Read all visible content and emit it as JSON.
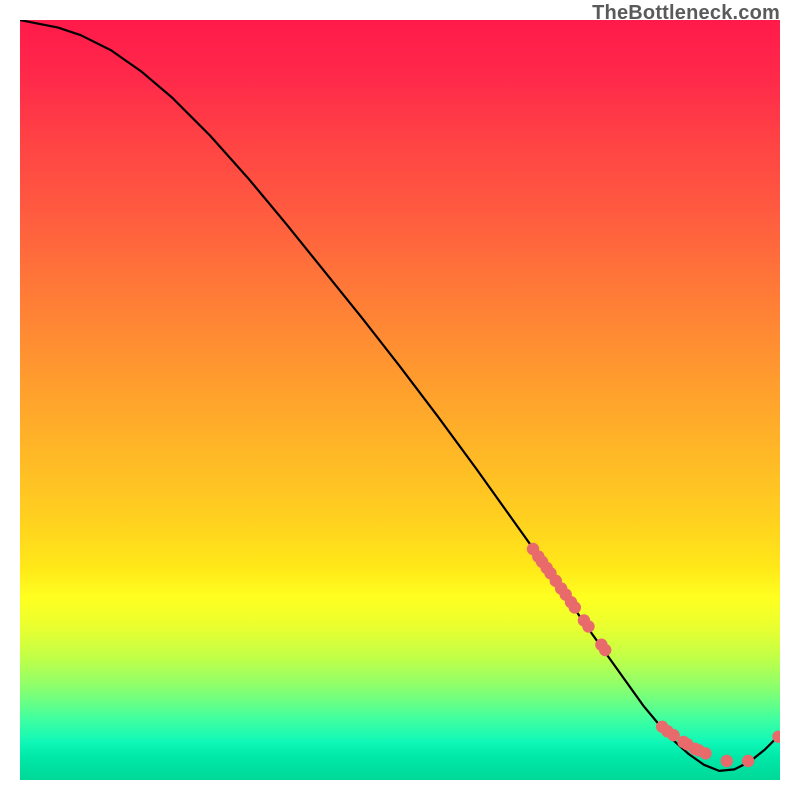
{
  "watermark": "TheBottleneck.com",
  "chart_data": {
    "type": "line",
    "title": "",
    "xlabel": "",
    "ylabel": "",
    "xlim": [
      0,
      100
    ],
    "ylim": [
      0,
      100
    ],
    "series": [
      {
        "name": "curve",
        "style": "line",
        "color": "#000000",
        "x": [
          0,
          2,
          5,
          8,
          12,
          16,
          20,
          25,
          30,
          35,
          40,
          45,
          50,
          55,
          60,
          65,
          70,
          72,
          74,
          76,
          78,
          80,
          82,
          84,
          86,
          88,
          90,
          92,
          94,
          96,
          98,
          100
        ],
        "y": [
          100,
          99.6,
          99,
          98,
          96,
          93.2,
          89.8,
          84.8,
          79.2,
          73.2,
          67,
          60.8,
          54.4,
          47.8,
          41,
          34,
          27,
          24,
          21,
          18.2,
          15.4,
          12.6,
          9.8,
          7.4,
          5.2,
          3.4,
          2,
          1.2,
          1.4,
          2.4,
          4,
          6
        ]
      },
      {
        "name": "upper-segment-points",
        "style": "points",
        "color": "#e86a6a",
        "x": [
          67.5,
          68.2,
          68.7,
          69.3,
          69.8,
          70.5,
          71.2,
          71.8,
          72.5,
          73.0,
          74.2,
          74.8,
          76.5,
          77.0
        ],
        "y": [
          30.4,
          29.4,
          28.7,
          27.9,
          27.2,
          26.2,
          25.2,
          24.4,
          23.4,
          22.7,
          21.0,
          20.2,
          17.8,
          17.1
        ]
      },
      {
        "name": "baseline-points",
        "style": "points",
        "color": "#e86a6a",
        "x": [
          84.5,
          85.2,
          86.0,
          87.3,
          87.8,
          88.8,
          89.3,
          90.2,
          93.0,
          95.8,
          99.8
        ],
        "y": [
          7.0,
          6.4,
          5.9,
          5.0,
          4.7,
          4.1,
          3.9,
          3.5,
          2.5,
          2.5,
          5.7
        ]
      }
    ]
  }
}
